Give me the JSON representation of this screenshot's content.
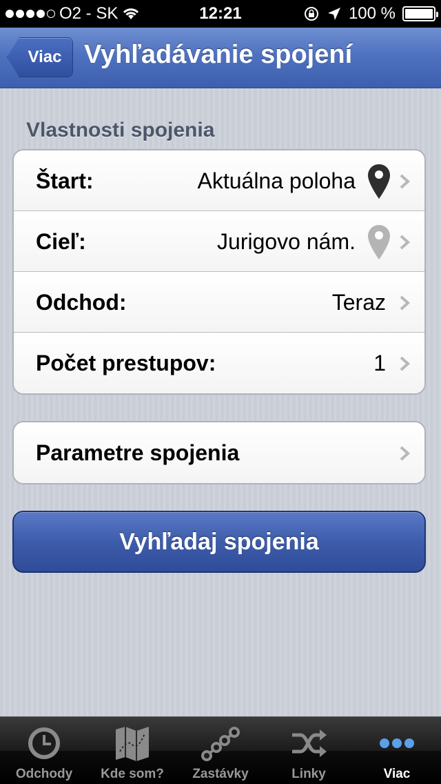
{
  "status_bar": {
    "carrier": "O2 - SK",
    "time": "12:21",
    "battery": "100 %"
  },
  "nav": {
    "back_label": "Viac",
    "title": "Vyhľadávanie spojení"
  },
  "section_title": "Vlastnosti spojenia",
  "rows": [
    {
      "label": "Štart:",
      "value": "Aktuálna poloha",
      "icon": "location-pin-dark"
    },
    {
      "label": "Cieľ:",
      "value": "Jurigovo nám.",
      "icon": "location-pin-light"
    },
    {
      "label": "Odchod:",
      "value": "Teraz"
    },
    {
      "label": "Počet prestupov:",
      "value": "1"
    }
  ],
  "params_row": {
    "label": "Parametre spojenia"
  },
  "search_button": "Vyhľadaj spojenia",
  "tabs": [
    {
      "label": "Odchody",
      "icon": "clock-icon"
    },
    {
      "label": "Kde som?",
      "icon": "map-icon"
    },
    {
      "label": "Zastávky",
      "icon": "stops-icon"
    },
    {
      "label": "Linky",
      "icon": "shuffle-icon"
    },
    {
      "label": "Viac",
      "icon": "more-icon",
      "active": true
    }
  ],
  "colors": {
    "nav_blue": "#4f72c0",
    "button_blue": "#3d5cab",
    "active_tab": "#5aa0ea"
  }
}
